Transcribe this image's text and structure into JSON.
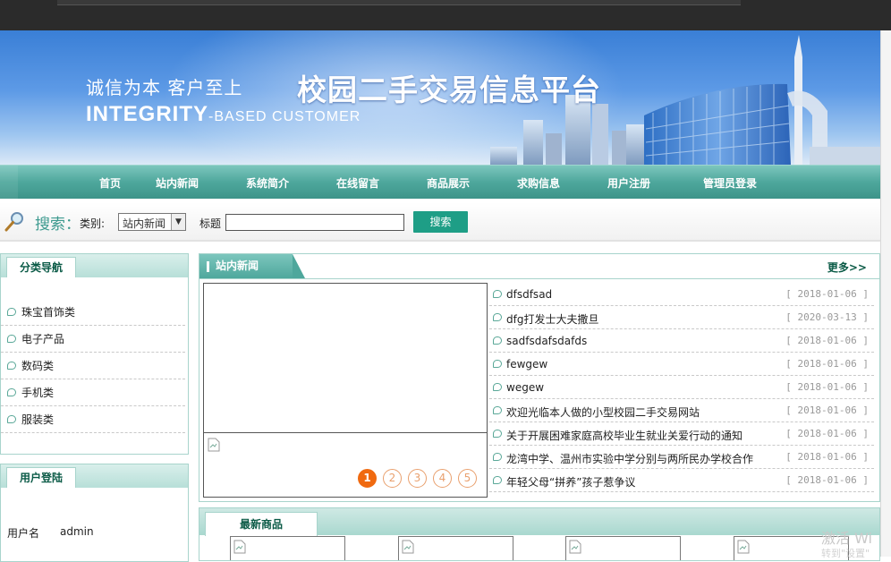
{
  "colors": {
    "accent": "#4ea79c",
    "nav_text": "#ffffff",
    "pager_active": "#f06a10",
    "search_button": "#1e9e86"
  },
  "banner": {
    "slogan": "诚信为本 客户至上",
    "title": "校园二手交易信息平台",
    "english_bold": "INTEGRITY",
    "english_rest": "-BASED CUSTOMER"
  },
  "nav": {
    "items": [
      {
        "label": "首页"
      },
      {
        "label": "站内新闻"
      },
      {
        "label": "系统简介"
      },
      {
        "label": "在线留言"
      },
      {
        "label": "商品展示"
      },
      {
        "label": "求购信息"
      },
      {
        "label": "用户注册"
      },
      {
        "label": "管理员登录"
      }
    ]
  },
  "search": {
    "label": "搜索：",
    "category_label": "类别:",
    "category_value": "站内新闻",
    "title_label": "标题",
    "title_value": "",
    "button": "搜索",
    "icon": "magnifier-icon"
  },
  "sidebar": {
    "category_title": "分类导航",
    "categories": [
      "珠宝首饰类",
      "电子产品",
      "数码类",
      "手机类",
      "服装类"
    ],
    "login_title": "用户登陆",
    "username_label": "用户名",
    "username_value": "admin"
  },
  "news": {
    "title": "站内新闻",
    "more": "更多>>",
    "pages": [
      "1",
      "2",
      "3",
      "4",
      "5"
    ],
    "active_page": "1",
    "items": [
      {
        "title": "dfsdfsad",
        "date": "[ 2018-01-06 ]"
      },
      {
        "title": "dfg打发士大夫撒旦",
        "date": "[ 2020-03-13 ]"
      },
      {
        "title": "sadfsdafsdafds",
        "date": "[ 2018-01-06 ]"
      },
      {
        "title": "fewgew",
        "date": "[ 2018-01-06 ]"
      },
      {
        "title": "wegew",
        "date": "[ 2018-01-06 ]"
      },
      {
        "title": "欢迎光临本人做的小型校园二手交易网站",
        "date": "[ 2018-01-06 ]"
      },
      {
        "title": "关于开展困难家庭高校毕业生就业关爱行动的通知",
        "date": "[ 2018-01-06 ]"
      },
      {
        "title": "龙湾中学、温州市实验中学分别与两所民办学校合作",
        "date": "[ 2018-01-06 ]"
      },
      {
        "title": "年轻父母“拼养”孩子惹争议",
        "date": "[ 2018-01-06 ]"
      }
    ]
  },
  "products": {
    "title": "最新商品"
  },
  "watermark": {
    "line1": "激活 Wi",
    "line2": "转到\"设置\""
  }
}
